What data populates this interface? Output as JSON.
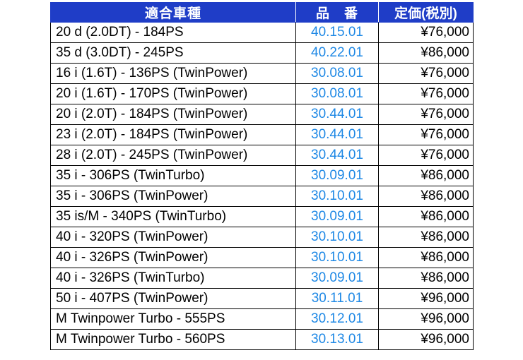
{
  "colors": {
    "header_bg": "#1f3dc7",
    "header_text": "#ffffff",
    "part_number_text": "#1e88e5",
    "body_text": "#000000",
    "grid": "#000000"
  },
  "table": {
    "headers": [
      "適合車種",
      "品　番",
      "定価(税別)"
    ],
    "rows": [
      {
        "model": "20 d (2.0DT) - 184PS",
        "part": "40.15.01",
        "price": "¥76,000"
      },
      {
        "model": "35 d (3.0DT) - 245PS",
        "part": "40.22.01",
        "price": "¥86,000"
      },
      {
        "model": "16 i (1.6T) - 136PS (TwinPower)",
        "part": "30.08.01",
        "price": "¥76,000"
      },
      {
        "model": "20 i (1.6T) - 170PS (TwinPower)",
        "part": "30.08.01",
        "price": "¥76,000"
      },
      {
        "model": "20 i (2.0T) - 184PS (TwinPower)",
        "part": "30.44.01",
        "price": "¥76,000"
      },
      {
        "model": "23 i (2.0T) - 184PS (TwinPower)",
        "part": "30.44.01",
        "price": "¥76,000"
      },
      {
        "model": "28 i (2.0T) - 245PS (TwinPower)",
        "part": "30.44.01",
        "price": "¥76,000"
      },
      {
        "model": "35 i - 306PS (TwinTurbo)",
        "part": "30.09.01",
        "price": "¥86,000"
      },
      {
        "model": "35 i - 306PS (TwinPower)",
        "part": "30.10.01",
        "price": "¥86,000"
      },
      {
        "model": "35 is/M - 340PS (TwinTurbo)",
        "part": "30.09.01",
        "price": "¥86,000"
      },
      {
        "model": "40 i - 320PS (TwinPower)",
        "part": "30.10.01",
        "price": "¥86,000"
      },
      {
        "model": "40 i - 326PS (TwinPower)",
        "part": "30.10.01",
        "price": "¥86,000"
      },
      {
        "model": "40 i - 326PS (TwinTurbo)",
        "part": "30.09.01",
        "price": "¥86,000"
      },
      {
        "model": "50 i - 407PS (TwinPower)",
        "part": "30.11.01",
        "price": "¥96,000"
      },
      {
        "model": "M Twinpower Turbo - 555PS",
        "part": "30.12.01",
        "price": "¥96,000"
      },
      {
        "model": "M Twinpower Turbo - 560PS",
        "part": "30.13.01",
        "price": "¥96,000"
      }
    ]
  }
}
